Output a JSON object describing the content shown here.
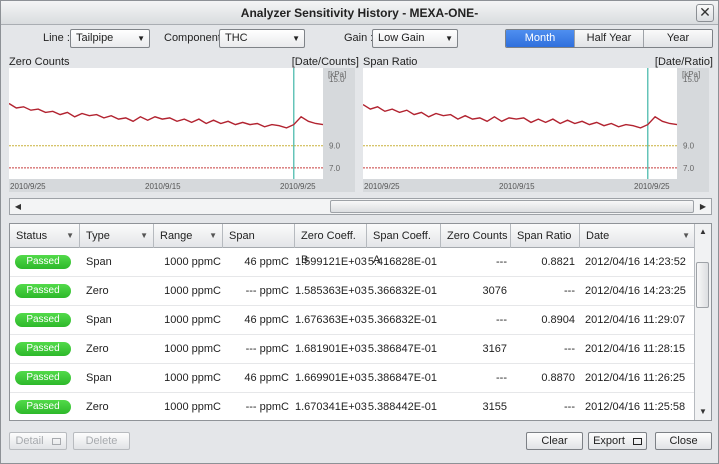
{
  "window": {
    "title": "Analyzer Sensitivity History - MEXA-ONE-",
    "close_glyph": "✕"
  },
  "controls": {
    "line_label": "Line :",
    "line_value": "Tailpipe",
    "component_label": "Component :",
    "component_value": "THC",
    "gain_label": "Gain :",
    "gain_value": "Low Gain",
    "range_tabs": [
      "Month",
      "Half Year",
      "Year"
    ],
    "active_range": "Month"
  },
  "chart_data": [
    {
      "type": "line",
      "title": "Zero Counts",
      "unit_label": "[Date/Counts]",
      "y_unit": "[kPa]",
      "y_ticks": [
        "15.0",
        "9.0",
        "7.0"
      ],
      "x_tick_labels": [
        "2010/9/25",
        "2010/9/15",
        "2010/9/25"
      ],
      "ylim": [
        6.0,
        16.0
      ],
      "reference_lines": [
        {
          "value": 9.0,
          "color": "#c9b13a"
        },
        {
          "value": 7.0,
          "color": "#c73c3c"
        }
      ],
      "marker_color": "#3fb7a8",
      "series_color": "#b22330",
      "values": [
        12.8,
        12.4,
        12.5,
        12.2,
        12.3,
        12.0,
        12.1,
        11.8,
        12.0,
        11.6,
        11.9,
        11.7,
        11.8,
        11.5,
        11.7,
        11.4,
        11.5,
        11.2,
        11.6,
        11.3,
        11.6,
        11.4,
        11.5,
        11.2,
        11.4,
        11.1,
        11.4,
        11.0,
        11.3,
        11.0,
        11.2,
        10.9,
        11.1,
        10.9,
        11.0,
        10.7,
        10.9,
        10.8,
        10.6,
        10.9,
        11.6,
        11.2,
        11.0,
        10.9
      ],
      "marker_index": 39
    },
    {
      "type": "line",
      "title": "Span Ratio",
      "unit_label": "[Date/Ratio]",
      "y_unit": "[kPa]",
      "y_ticks": [
        "15.0",
        "9.0",
        "7.0"
      ],
      "x_tick_labels": [
        "2010/9/25",
        "2010/9/15",
        "2010/9/25"
      ],
      "ylim": [
        6.0,
        16.0
      ],
      "reference_lines": [
        {
          "value": 9.0,
          "color": "#c9b13a"
        },
        {
          "value": 7.0,
          "color": "#c73c3c"
        }
      ],
      "marker_color": "#3fb7a8",
      "series_color": "#b22330",
      "values": [
        12.7,
        12.3,
        12.5,
        12.1,
        12.3,
        12.0,
        12.2,
        11.8,
        12.0,
        11.6,
        11.9,
        11.7,
        11.8,
        11.4,
        11.7,
        11.4,
        11.5,
        11.2,
        11.6,
        11.2,
        11.5,
        11.4,
        11.5,
        11.1,
        11.4,
        11.1,
        11.4,
        11.0,
        11.3,
        11.0,
        11.2,
        10.9,
        11.1,
        10.8,
        11.0,
        10.7,
        10.9,
        10.8,
        10.6,
        10.9,
        11.6,
        11.2,
        11.0,
        10.9
      ],
      "marker_index": 39
    }
  ],
  "table": {
    "columns": [
      "Status",
      "Type",
      "Range",
      "Span",
      "Zero Coeff. B",
      "Span Coeff. A",
      "Zero Counts",
      "Span Ratio",
      "Date"
    ],
    "sortable": [
      true,
      true,
      true,
      false,
      false,
      false,
      false,
      false,
      true
    ],
    "rows": [
      {
        "status": "Passed",
        "type": "Span",
        "range": "1000 ppmC",
        "span": "46 ppmC",
        "zero_b": "1.599121E+03",
        "span_a": "5.416828E-01",
        "zero_counts": "---",
        "span_ratio": "0.8821",
        "date": "2012/04/16 14:23:52"
      },
      {
        "status": "Passed",
        "type": "Zero",
        "range": "1000 ppmC",
        "span": "--- ppmC",
        "zero_b": "1.585363E+03",
        "span_a": "5.366832E-01",
        "zero_counts": "3076",
        "span_ratio": "---",
        "date": "2012/04/16 14:23:25"
      },
      {
        "status": "Passed",
        "type": "Span",
        "range": "1000 ppmC",
        "span": "46 ppmC",
        "zero_b": "1.676363E+03",
        "span_a": "5.366832E-01",
        "zero_counts": "---",
        "span_ratio": "0.8904",
        "date": "2012/04/16 11:29:07"
      },
      {
        "status": "Passed",
        "type": "Zero",
        "range": "1000 ppmC",
        "span": "--- ppmC",
        "zero_b": "1.681901E+03",
        "span_a": "5.386847E-01",
        "zero_counts": "3167",
        "span_ratio": "---",
        "date": "2012/04/16 11:28:15"
      },
      {
        "status": "Passed",
        "type": "Span",
        "range": "1000 ppmC",
        "span": "46 ppmC",
        "zero_b": "1.669901E+03",
        "span_a": "5.386847E-01",
        "zero_counts": "---",
        "span_ratio": "0.8870",
        "date": "2012/04/16 11:26:25"
      },
      {
        "status": "Passed",
        "type": "Zero",
        "range": "1000 ppmC",
        "span": "--- ppmC",
        "zero_b": "1.670341E+03",
        "span_a": "5.388442E-01",
        "zero_counts": "3155",
        "span_ratio": "---",
        "date": "2012/04/16 11:25:58"
      }
    ]
  },
  "footer": {
    "detail_label": "Detail",
    "delete_label": "Delete",
    "clear_label": "Clear",
    "export_label": "Export",
    "close_label": "Close"
  },
  "icons": {
    "dropdown": "chevron-down-icon",
    "scroll_left": "arrow-left-icon",
    "scroll_right": "arrow-right-icon",
    "scroll_up": "arrow-up-icon",
    "scroll_down": "arrow-down-icon"
  }
}
